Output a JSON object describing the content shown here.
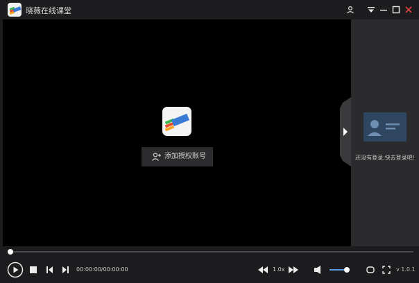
{
  "window": {
    "title": "晓薇在线课堂"
  },
  "titlebar_icons": [
    "user-icon",
    "menu-down-icon",
    "minimize-icon",
    "maximize-icon",
    "close-icon"
  ],
  "player": {
    "add_account_label": "添加授权账号",
    "time": "00:00:00/00:00:00",
    "speed": "1.0x",
    "progress": 0,
    "volume": 0.9,
    "version": "v 1.0.1"
  },
  "side_panel": {
    "login_prompt": "还没有登录,快去登录吧!"
  },
  "colors": {
    "accent": "#5aa0e8",
    "close": "#e04545"
  }
}
